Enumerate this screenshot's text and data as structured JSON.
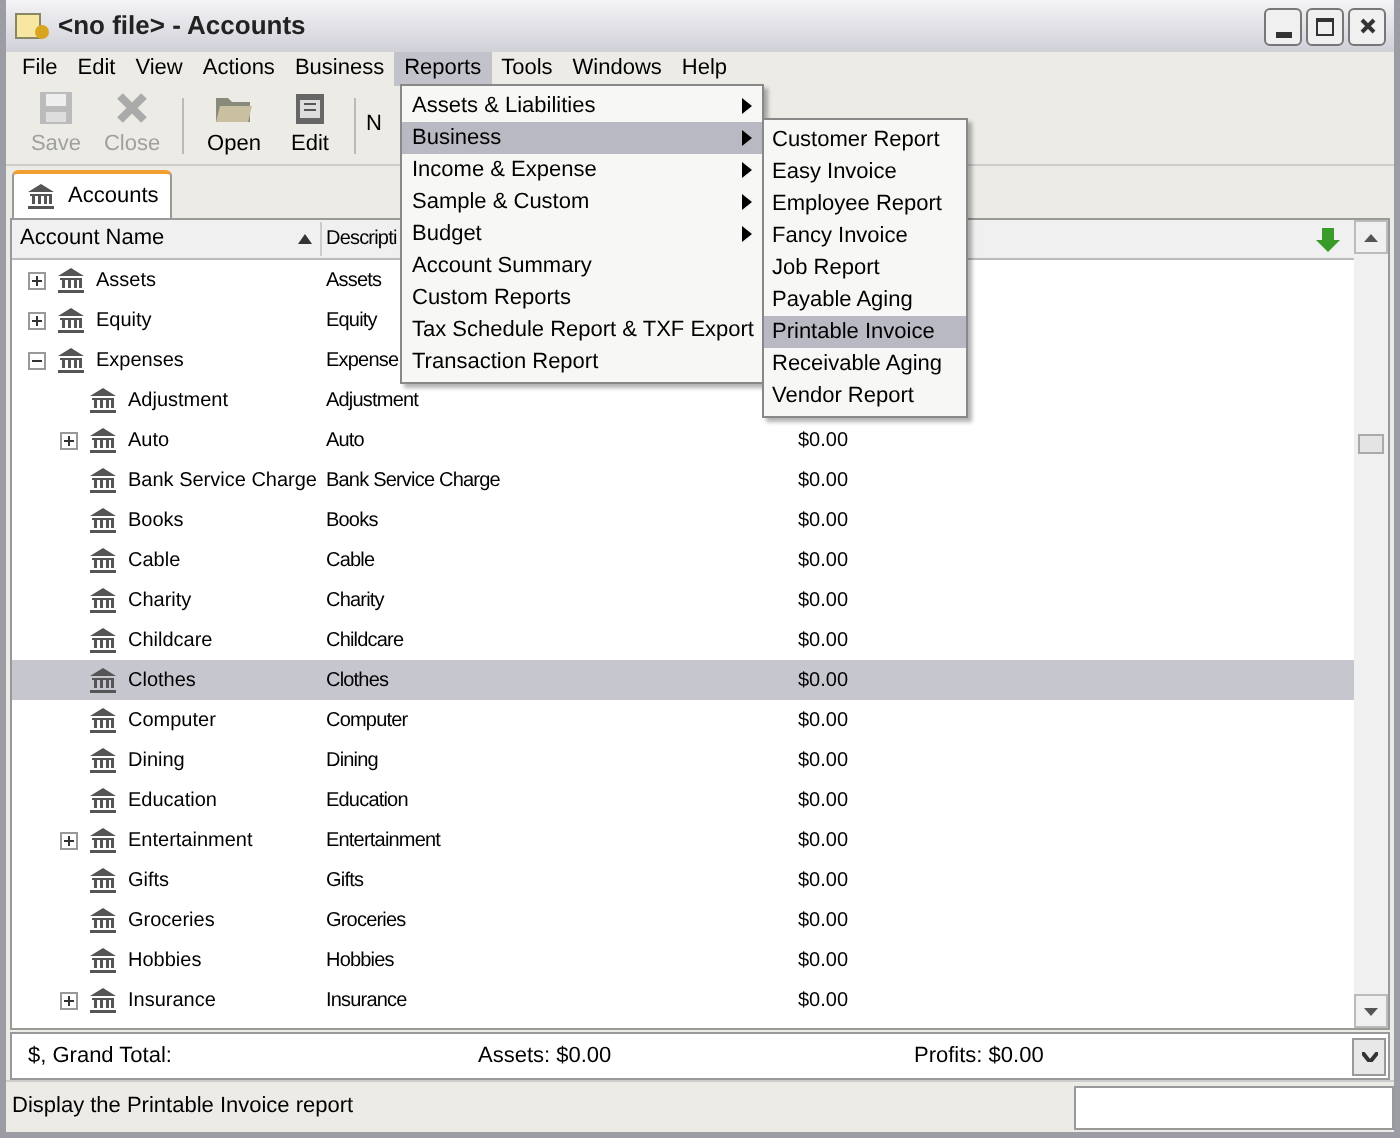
{
  "window": {
    "title": "<no file> - Accounts"
  },
  "menu_bar": [
    {
      "label": "File",
      "selected": false
    },
    {
      "label": "Edit",
      "selected": false
    },
    {
      "label": "View",
      "selected": false
    },
    {
      "label": "Actions",
      "selected": false
    },
    {
      "label": "Business",
      "selected": false
    },
    {
      "label": "Reports",
      "selected": true
    },
    {
      "label": "Tools",
      "selected": false
    },
    {
      "label": "Windows",
      "selected": false
    },
    {
      "label": "Help",
      "selected": false
    }
  ],
  "toolbar": [
    {
      "kind": "save",
      "label": "Save",
      "disabled": true
    },
    {
      "kind": "close",
      "label": "Close",
      "disabled": true
    },
    {
      "kind": "open",
      "label": "Open",
      "disabled": false
    },
    {
      "kind": "edit",
      "label": "Edit",
      "disabled": false
    },
    {
      "kind": "partial",
      "label": "N",
      "disabled": false
    }
  ],
  "tabs": [
    {
      "label": "Accounts",
      "selected": true
    }
  ],
  "table": {
    "columns": [
      "Account Name",
      "Descripti"
    ],
    "rows": [
      {
        "name": "Assets",
        "description": "Assets",
        "expanded": false,
        "selected": false
      },
      {
        "name": "Equity",
        "description": "Equity",
        "expanded": false,
        "selected": false
      },
      {
        "name": "Expenses",
        "description": "Expense",
        "expanded": true,
        "selected": false,
        "children": [
          {
            "name": "Adjustment",
            "description": "Adjustment",
            "selected": false
          },
          {
            "name": "Auto",
            "description": "Auto",
            "total": "$0.00",
            "expanded": false,
            "selected": false
          },
          {
            "name": "Bank Service Charge",
            "description": "Bank Service Charge",
            "total": "$0.00",
            "selected": false
          },
          {
            "name": "Books",
            "description": "Books",
            "total": "$0.00",
            "selected": false
          },
          {
            "name": "Cable",
            "description": "Cable",
            "total": "$0.00",
            "selected": false
          },
          {
            "name": "Charity",
            "description": "Charity",
            "total": "$0.00",
            "selected": false
          },
          {
            "name": "Childcare",
            "description": "Childcare",
            "total": "$0.00",
            "selected": false
          },
          {
            "name": "Clothes",
            "description": "Clothes",
            "total": "$0.00",
            "selected": true
          },
          {
            "name": "Computer",
            "description": "Computer",
            "total": "$0.00",
            "selected": false
          },
          {
            "name": "Dining",
            "description": "Dining",
            "total": "$0.00",
            "selected": false
          },
          {
            "name": "Education",
            "description": "Education",
            "total": "$0.00",
            "selected": false
          },
          {
            "name": "Entertainment",
            "description": "Entertainment",
            "total": "$0.00",
            "expanded": false,
            "selected": false
          },
          {
            "name": "Gifts",
            "description": "Gifts",
            "total": "$0.00",
            "selected": false
          },
          {
            "name": "Groceries",
            "description": "Groceries",
            "total": "$0.00",
            "selected": false
          },
          {
            "name": "Hobbies",
            "description": "Hobbies",
            "total": "$0.00",
            "selected": false
          },
          {
            "name": "Insurance",
            "description": "Insurance",
            "total": "$0.00",
            "expanded": false,
            "selected": false
          }
        ]
      }
    ]
  },
  "reports_menu": [
    {
      "label": "Assets & Liabilities",
      "submenu": true,
      "selected": false
    },
    {
      "label": "Business",
      "submenu": true,
      "selected": true
    },
    {
      "label": "Income & Expense",
      "submenu": true,
      "selected": false
    },
    {
      "label": "Sample & Custom",
      "submenu": true,
      "selected": false
    },
    {
      "label": "Budget",
      "submenu": true,
      "selected": false
    },
    {
      "label": "Account Summary",
      "submenu": false,
      "selected": false
    },
    {
      "label": "Custom Reports",
      "submenu": false,
      "selected": false
    },
    {
      "label": "Tax Schedule Report & TXF Export",
      "submenu": false,
      "selected": false
    },
    {
      "label": "Transaction Report",
      "submenu": false,
      "selected": false
    }
  ],
  "business_submenu": [
    {
      "label": "Customer Report",
      "selected": false
    },
    {
      "label": "Easy Invoice",
      "selected": false
    },
    {
      "label": "Employee Report",
      "selected": false
    },
    {
      "label": "Fancy Invoice",
      "selected": false
    },
    {
      "label": "Job Report",
      "selected": false
    },
    {
      "label": "Payable Aging",
      "selected": false
    },
    {
      "label": "Printable Invoice",
      "selected": true
    },
    {
      "label": "Receivable Aging",
      "selected": false
    },
    {
      "label": "Vendor Report",
      "selected": false
    }
  ],
  "grand_total": {
    "label": "$, Grand Total:",
    "assets": "Assets: $0.00",
    "profits": "Profits: $0.00"
  },
  "status_bar": {
    "message": "Display the Printable Invoice report"
  }
}
